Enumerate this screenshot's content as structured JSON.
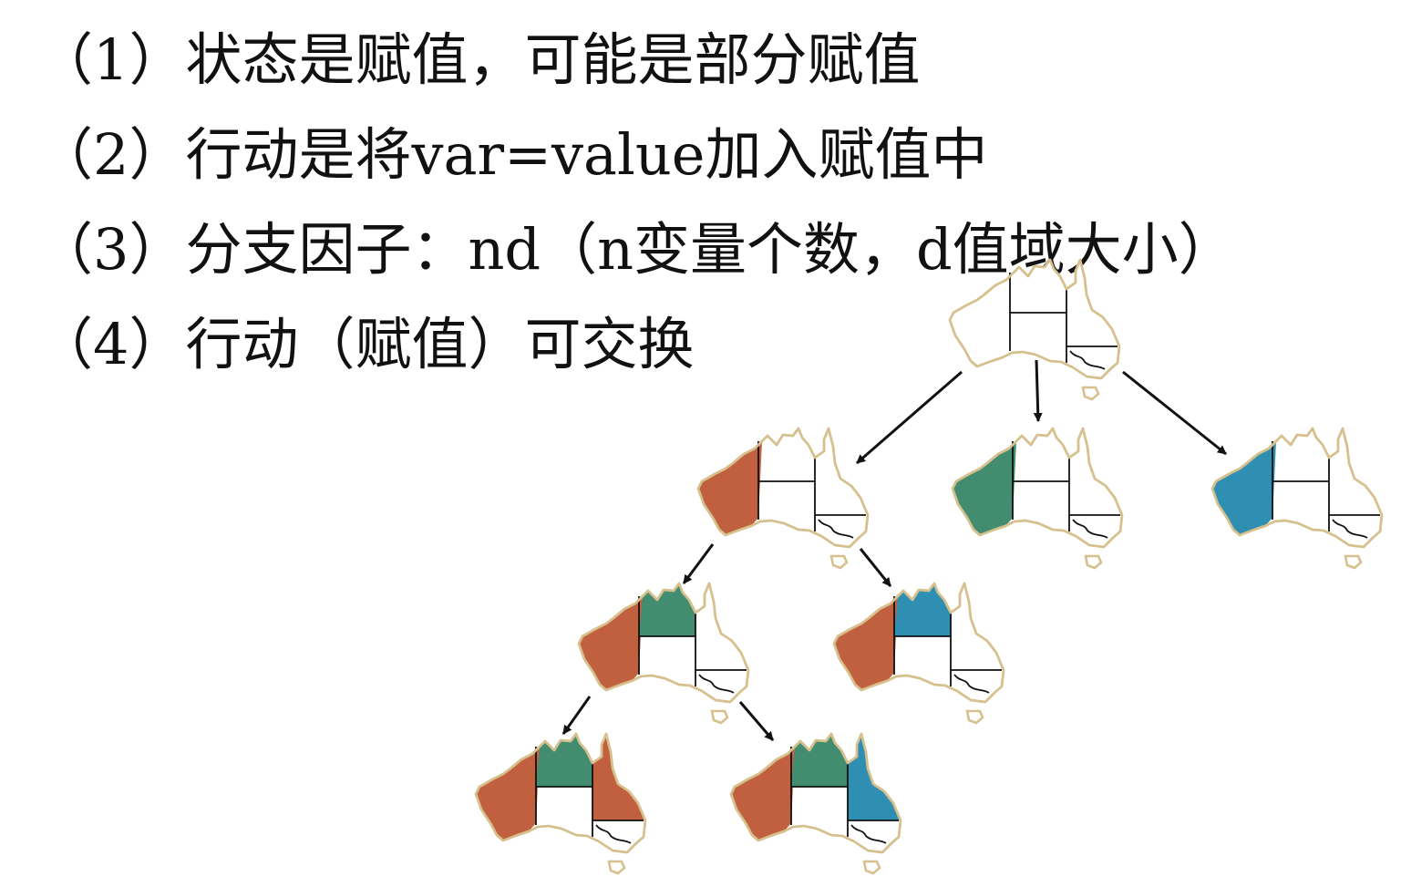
{
  "bullets": [
    "（1）状态是赋值，可能是部分赋值",
    "（2）行动是将var=value加入赋值中",
    "（3）分支因子：nd（n变量个数，d值域大小）",
    "（4）行动（赋值）可交换"
  ],
  "colors": {
    "outline": "#d6c08e",
    "border": "#111111",
    "red": "#c0603f",
    "green": "#428d70",
    "blue": "#2f8fb3",
    "arrow": "#111111",
    "text": "#111111"
  },
  "search_tree": {
    "regions": [
      "WA",
      "NT",
      "Q",
      "SA",
      "NSW",
      "V",
      "T"
    ],
    "nodes": [
      {
        "id": "root",
        "assignment": {}
      },
      {
        "id": "wa-red",
        "assignment": {
          "WA": "red"
        }
      },
      {
        "id": "wa-green",
        "assignment": {
          "WA": "green"
        }
      },
      {
        "id": "wa-blue",
        "assignment": {
          "WA": "blue"
        }
      },
      {
        "id": "wa-red-nt-green",
        "assignment": {
          "WA": "red",
          "NT": "green"
        }
      },
      {
        "id": "wa-red-nt-blue",
        "assignment": {
          "WA": "red",
          "NT": "blue"
        }
      },
      {
        "id": "wa-red-nt-green-q-red",
        "assignment": {
          "WA": "red",
          "NT": "green",
          "Q": "red"
        }
      },
      {
        "id": "wa-red-nt-green-q-blue",
        "assignment": {
          "WA": "red",
          "NT": "green",
          "Q": "blue"
        }
      }
    ],
    "edges": [
      {
        "from": "root",
        "to": "wa-red"
      },
      {
        "from": "root",
        "to": "wa-green"
      },
      {
        "from": "root",
        "to": "wa-blue"
      },
      {
        "from": "wa-red",
        "to": "wa-red-nt-green"
      },
      {
        "from": "wa-red",
        "to": "wa-red-nt-blue"
      },
      {
        "from": "wa-red-nt-green",
        "to": "wa-red-nt-green-q-red"
      },
      {
        "from": "wa-red-nt-green",
        "to": "wa-red-nt-green-q-blue"
      }
    ]
  }
}
